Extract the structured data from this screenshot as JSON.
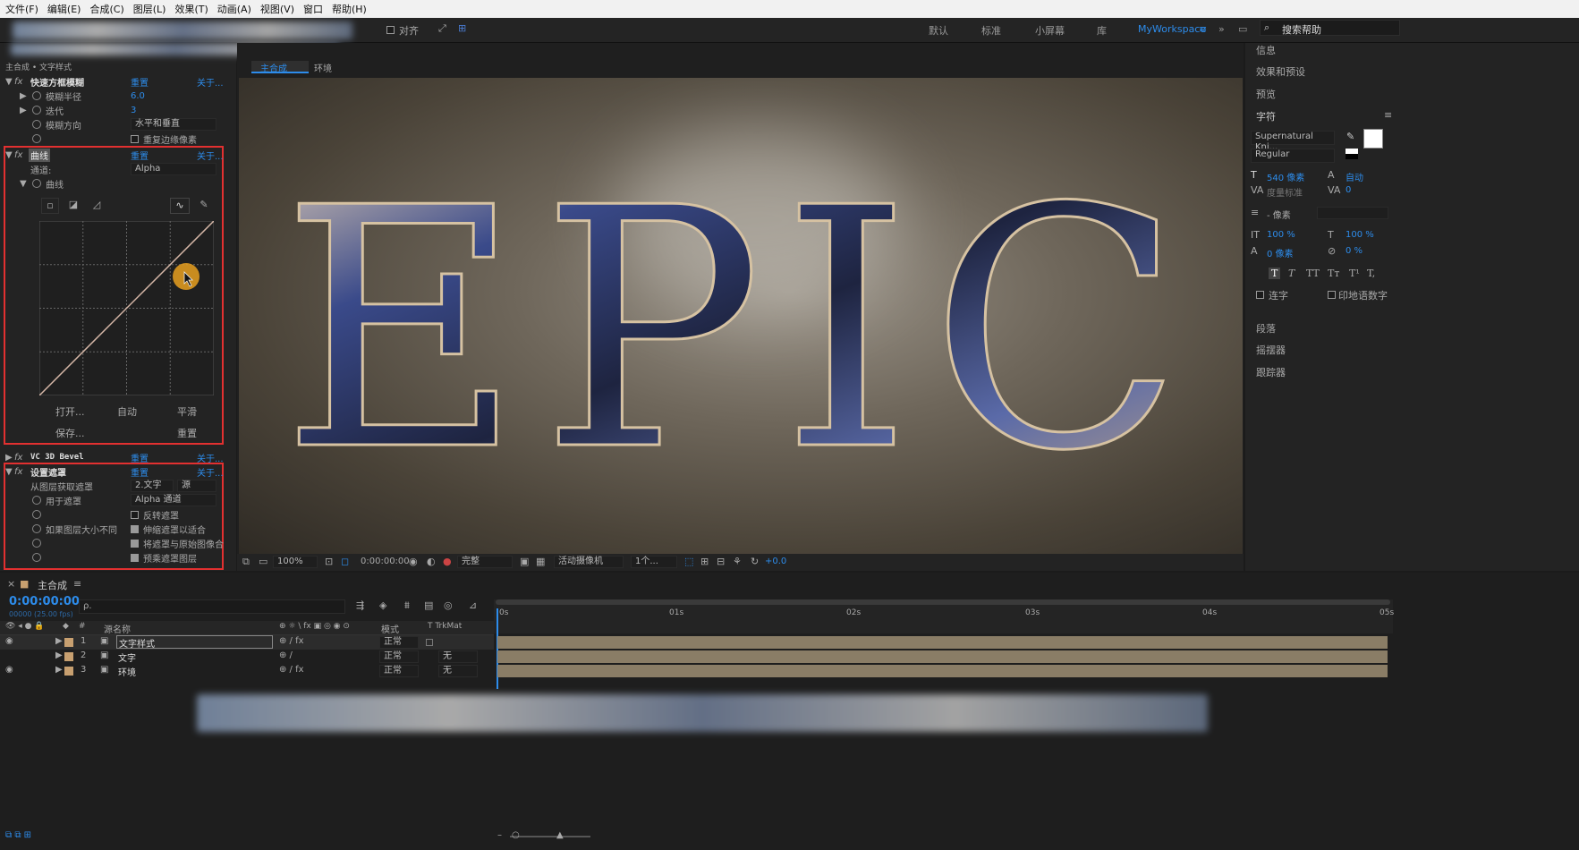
{
  "menu": [
    "文件(F)",
    "编辑(E)",
    "合成(C)",
    "图层(L)",
    "效果(T)",
    "动画(A)",
    "视图(V)",
    "窗口",
    "帮助(H)"
  ],
  "toolbar": {
    "align_label": "对齐",
    "workspaces": [
      "默认",
      "标准",
      "小屏幕",
      "库"
    ],
    "active_workspace": "MyWorkspace",
    "search_placeholder": "搜索帮助"
  },
  "effects_panel": {
    "breadcrumb": "主合成 • 文字样式",
    "reset": "重置",
    "about": "关于...",
    "blur": {
      "name": "快速方框模糊",
      "radius_label": "模糊半径",
      "radius_value": "6.0",
      "iter_label": "迭代",
      "iter_value": "3",
      "dir_label": "模糊方向",
      "dir_value": "水平和垂直",
      "repeat_label": "重复边缘像素"
    },
    "curves": {
      "name": "曲线",
      "channel_label": "通道:",
      "channel_value": "Alpha",
      "curve_label": "曲线",
      "open": "打开...",
      "auto": "自动",
      "smooth": "平滑",
      "save": "保存...",
      "reset": "重置"
    },
    "bevel": {
      "name": "VC 3D Bevel"
    },
    "setmatte": {
      "name": "设置遮罩",
      "from_layer_label": "从图层获取遮罩",
      "from_layer_value": "2.文字",
      "source_value": "源",
      "use_label": "用于遮罩",
      "use_value": "Alpha 通道",
      "invert_label": "反转遮罩",
      "size_label": "如果图层大小不同",
      "stretch_label": "伸缩遮罩以适合",
      "composite_label": "将遮罩与原始图像合",
      "premult_label": "预乘遮罩图层"
    }
  },
  "viewer": {
    "tab_main": "主合成",
    "tab_env": "环境",
    "title_text": "EPIC",
    "zoom": "100%",
    "timecode": "0:00:00:00",
    "resolution": "完整",
    "camera": "活动摄像机",
    "views": "1个...",
    "exposure": "+0.0"
  },
  "right_panel": {
    "info": "信息",
    "effects_presets": "效果和预设",
    "preview": "预览",
    "character": "字符",
    "font": "Supernatural Kni...",
    "style": "Regular",
    "size": "540 像素",
    "leading": "自动",
    "kerning": "度量标准",
    "tracking": "0",
    "stroke": "- 像素",
    "vscale": "100 %",
    "hscale": "100 %",
    "baseline": "0 像素",
    "tsume": "0 %",
    "ligatures": "连字",
    "hindi": "印地语数字",
    "paragraph": "段落",
    "wiggler": "摇摆器",
    "tracker": "跟踪器",
    "styles": [
      "T",
      "T",
      "TT",
      "Tт",
      "T¹",
      "T,"
    ]
  },
  "timeline": {
    "comp_name": "主合成",
    "time": "0:00:00:00",
    "fps": "00000 (25.00 fps)",
    "search_placeholder": "ρ.",
    "col_source": "源名称",
    "col_mode": "模式",
    "col_trkmat": "T TrkMat",
    "ruler": [
      "0s",
      "01s",
      "02s",
      "03s",
      "04s",
      "05s"
    ],
    "layers": [
      {
        "num": "1",
        "name": "文字样式",
        "mode": "正常",
        "trkmat": ""
      },
      {
        "num": "2",
        "name": "文字",
        "mode": "正常",
        "trkmat": "无"
      },
      {
        "num": "3",
        "name": "环境",
        "mode": "正常",
        "trkmat": "无"
      }
    ]
  }
}
